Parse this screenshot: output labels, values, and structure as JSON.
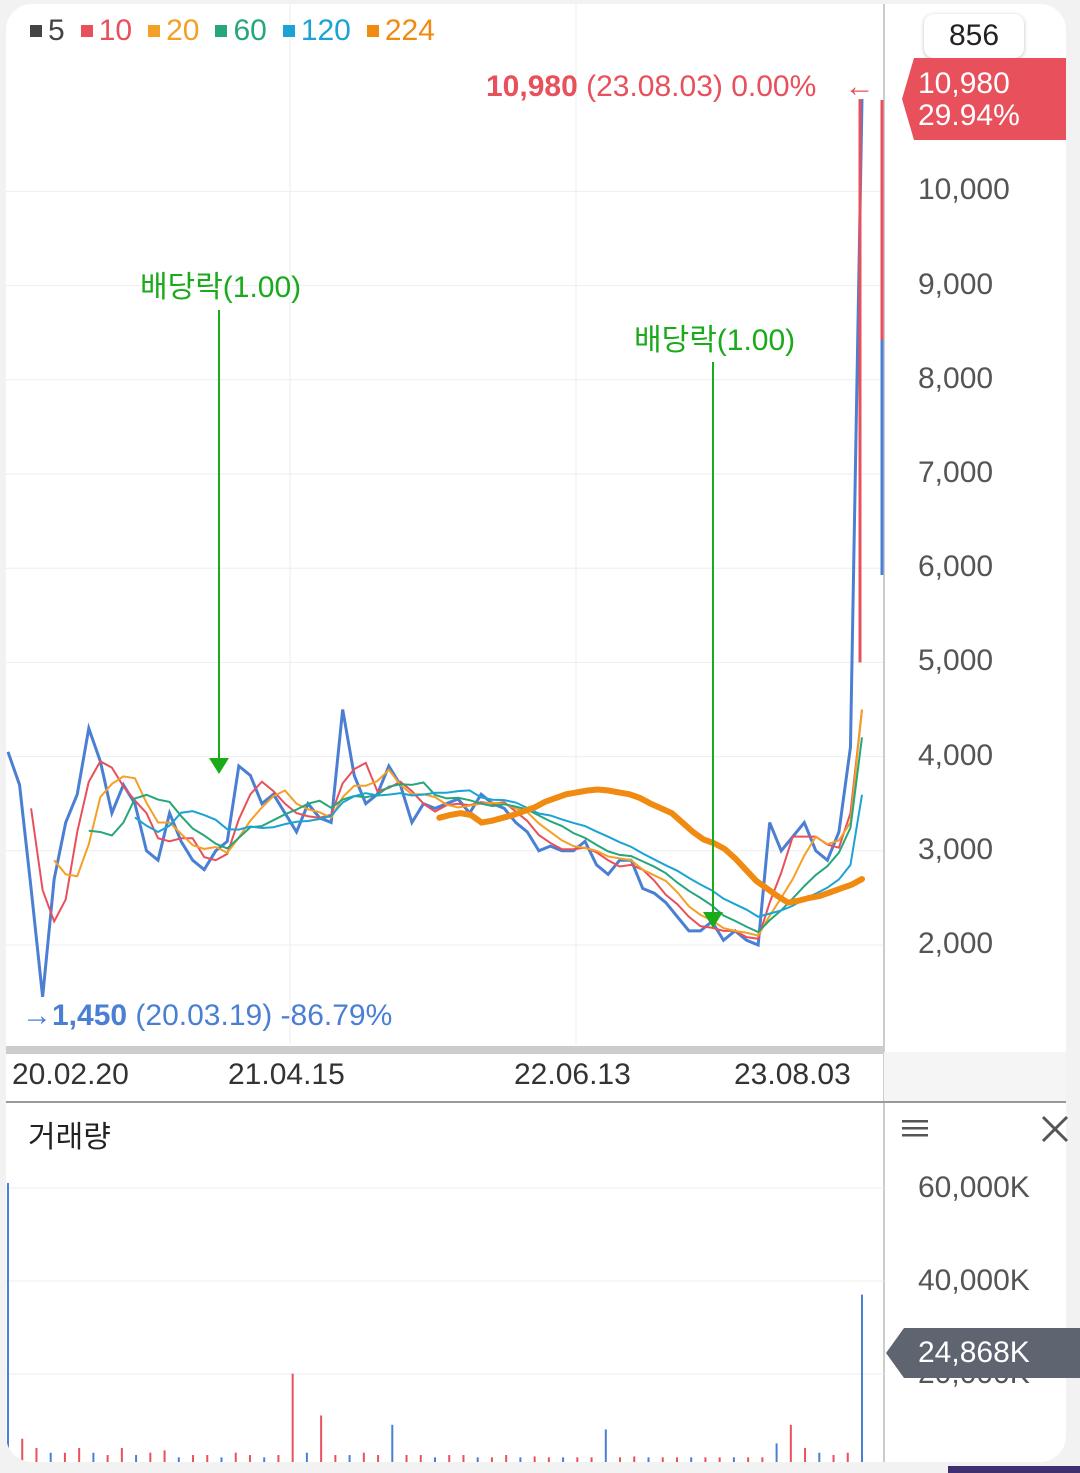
{
  "legend": [
    {
      "label": "5",
      "color": "#444444"
    },
    {
      "label": "10",
      "color": "#e8505b"
    },
    {
      "label": "20",
      "color": "#f4a026"
    },
    {
      "label": "60",
      "color": "#26a77a"
    },
    {
      "label": "120",
      "color": "#1ba3d4"
    },
    {
      "label": "224",
      "color": "#f08a10"
    }
  ],
  "top_button": "856",
  "current_tag": {
    "price": "10,980",
    "change": "29.94%"
  },
  "high_label": {
    "value": "10,980",
    "date": "(23.08.03)",
    "pct": "0.00%",
    "arrow": "←"
  },
  "low_label": {
    "arrow": "→",
    "value": "1,450",
    "date": "(20.03.19)",
    "pct": "-86.79%"
  },
  "annotations": [
    {
      "text": "배당락(1.00)"
    },
    {
      "text": "배당락(1.00)"
    }
  ],
  "price_ticks": [
    "10,000",
    "9,000",
    "8,000",
    "7,000",
    "6,000",
    "5,000",
    "4,000",
    "3,000",
    "2,000"
  ],
  "x_ticks": [
    "20.02.20",
    "21.04.15",
    "22.06.13",
    "23.08.03"
  ],
  "volume_panel": {
    "title": "거래량",
    "ticks": [
      "60,000K",
      "40,000K",
      "20,000K"
    ],
    "current_tag": "24,868K",
    "menu_icon": "hamburger-menu-icon",
    "close_icon": "close-icon"
  },
  "chart_data": {
    "type": "line",
    "ylim": [
      1000,
      11000
    ],
    "price_series": [
      {
        "name": "price",
        "color": "#4a7fd4",
        "values": [
          4050,
          3700,
          2600,
          1450,
          2700,
          3300,
          3600,
          4300,
          3950,
          3400,
          3700,
          3500,
          3000,
          2900,
          3400,
          3100,
          2900,
          2800,
          3000,
          3100,
          3900,
          3800,
          3500,
          3600,
          3400,
          3200,
          3500,
          3350,
          3300,
          4500,
          3800,
          3500,
          3600,
          3900,
          3700,
          3300,
          3500,
          3450,
          3500,
          3550,
          3400,
          3600,
          3500,
          3450,
          3300,
          3200,
          3000,
          3050,
          3000,
          3000,
          3100,
          2850,
          2750,
          2900,
          2900,
          2600,
          2550,
          2450,
          2300,
          2150,
          2150,
          2250,
          2050,
          2150,
          2050,
          2000,
          3300,
          3000,
          3150,
          3300,
          3000,
          2900,
          3200,
          4100,
          10980
        ]
      }
    ],
    "moving_averages": [
      {
        "name": "20",
        "color": "#f4a026"
      },
      {
        "name": "60",
        "color": "#26a77a"
      },
      {
        "name": "120",
        "color": "#1ba3d4"
      },
      {
        "name": "224",
        "color": "#f08a10",
        "values": [
          null,
          null,
          null,
          null,
          null,
          null,
          null,
          null,
          null,
          null,
          null,
          null,
          null,
          null,
          null,
          null,
          null,
          null,
          null,
          null,
          3350,
          3380,
          3400,
          3380,
          3300,
          3320,
          3350,
          3380,
          3420,
          3460,
          3520,
          3560,
          3600,
          3620,
          3640,
          3650,
          3640,
          3620,
          3600,
          3560,
          3500,
          3450,
          3400,
          3300,
          3200,
          3120,
          3080,
          3020,
          2920,
          2800,
          2680,
          2600,
          2520,
          2450,
          2470,
          2500,
          2520,
          2560,
          2600,
          2640,
          2700
        ]
      }
    ],
    "volume_ylim": [
      0,
      65000
    ],
    "volume_values": [
      60000,
      5000,
      3000,
      2000,
      2000,
      3000,
      2000,
      1500,
      3000,
      1500,
      2000,
      2500,
      1000,
      1500,
      1500,
      1000,
      2000,
      1500,
      1000,
      1500,
      19000,
      2000,
      10000,
      1500,
      1500,
      2000,
      1500,
      8000,
      1500,
      1500,
      1000,
      1500,
      1500,
      1000,
      1000,
      1500,
      1000,
      1200,
      1000,
      1000,
      1000,
      1000,
      7000,
      1000,
      1200,
      1000,
      1000,
      1000,
      1000,
      1000,
      1000,
      1000,
      1000,
      1000,
      4000,
      8000,
      3000,
      2000,
      1500,
      2000,
      36000
    ]
  }
}
